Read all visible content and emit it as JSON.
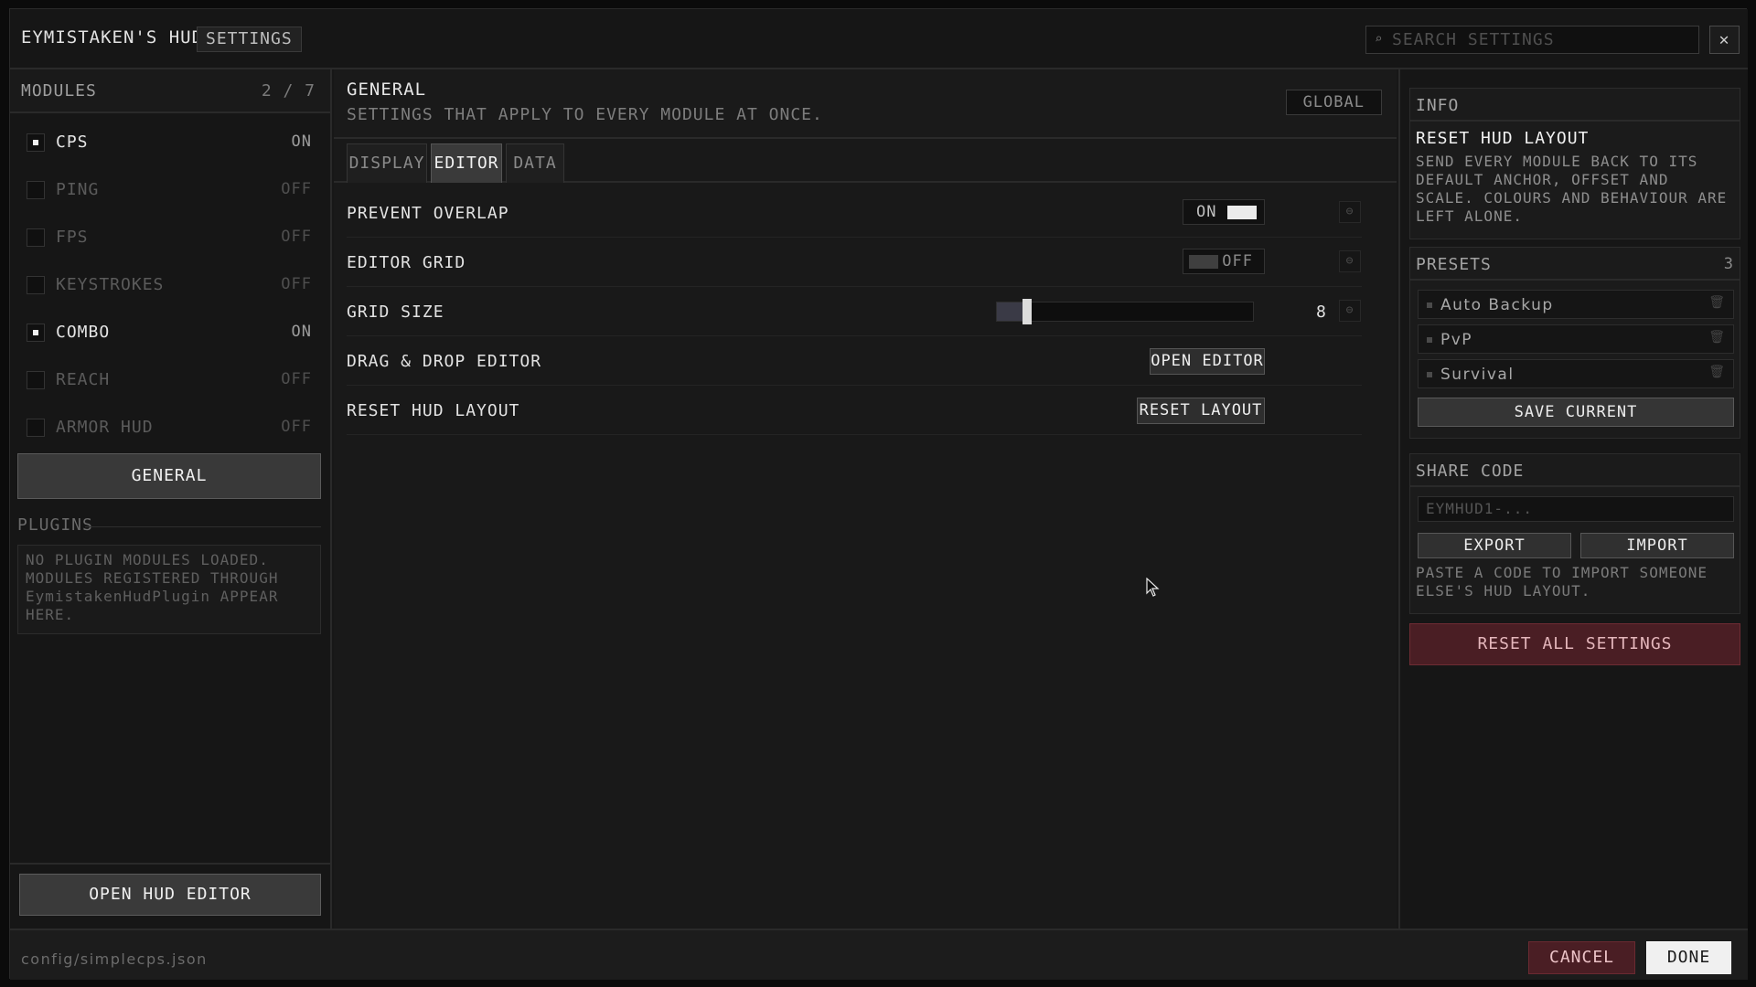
{
  "header": {
    "app_title": "EYMISTAKEN'S HUD",
    "tag": "SETTINGS",
    "search_placeholder": "SEARCH SETTINGS",
    "close_symbol": "✕"
  },
  "sidebar": {
    "title": "MODULES",
    "count": "2 / 7",
    "modules": [
      {
        "name": "CPS",
        "state": "ON",
        "enabled": true
      },
      {
        "name": "PING",
        "state": "OFF",
        "enabled": false
      },
      {
        "name": "FPS",
        "state": "OFF",
        "enabled": false
      },
      {
        "name": "KEYSTROKES",
        "state": "OFF",
        "enabled": false
      },
      {
        "name": "COMBO",
        "state": "ON",
        "enabled": true
      },
      {
        "name": "REACH",
        "state": "OFF",
        "enabled": false
      },
      {
        "name": "ARMOR HUD",
        "state": "OFF",
        "enabled": false
      }
    ],
    "general_button": "GENERAL",
    "plugins_label": "PLUGINS",
    "plugins_text": "NO PLUGIN MODULES LOADED. MODULES REGISTERED THROUGH EymistakenHudPlugin APPEAR HERE.",
    "open_hud_editor": "OPEN HUD EDITOR"
  },
  "main": {
    "title": "GENERAL",
    "subtitle": "SETTINGS THAT APPLY TO EVERY MODULE AT ONCE.",
    "scope_badge": "GLOBAL",
    "tabs": [
      {
        "label": "DISPLAY",
        "active": false
      },
      {
        "label": "EDITOR",
        "active": true
      },
      {
        "label": "DATA",
        "active": false
      }
    ],
    "settings": {
      "prevent_overlap": {
        "label": "PREVENT OVERLAP",
        "value": "ON"
      },
      "editor_grid": {
        "label": "EDITOR GRID",
        "value": "OFF"
      },
      "grid_size": {
        "label": "GRID SIZE",
        "value": "8",
        "fraction": 0.1
      },
      "drag_drop": {
        "label": "DRAG & DROP EDITOR",
        "button": "OPEN EDITOR"
      },
      "reset_layout": {
        "label": "RESET HUD LAYOUT",
        "button": "RESET LAYOUT"
      }
    }
  },
  "right": {
    "info": {
      "header": "INFO",
      "title": "RESET HUD LAYOUT",
      "body": "SEND EVERY MODULE BACK TO ITS DEFAULT ANCHOR, OFFSET AND SCALE. COLOURS AND BEHAVIOUR ARE LEFT ALONE."
    },
    "presets": {
      "header": "PRESETS",
      "count": "3",
      "items": [
        "Auto Backup",
        "PvP",
        "Survival"
      ],
      "save_button": "SAVE CURRENT"
    },
    "share": {
      "header": "SHARE CODE",
      "placeholder": "EYMHUD1-...",
      "export_button": "EXPORT",
      "import_button": "IMPORT",
      "hint": "PASTE A CODE TO IMPORT SOMEONE ELSE'S HUD LAYOUT."
    },
    "reset_all": "RESET ALL SETTINGS"
  },
  "footer": {
    "config_path": "config/simplecps.json",
    "cancel": "CANCEL",
    "done": "DONE"
  },
  "colors": {
    "danger_bg": "#4a1e24",
    "active_tab": "#3a3a3a",
    "toggle_on_knob": "#ececec"
  },
  "icons": {
    "search": "search-icon",
    "reset": "reset-icon",
    "trash": "trash-icon",
    "cursor": "mouse-pointer-icon"
  }
}
